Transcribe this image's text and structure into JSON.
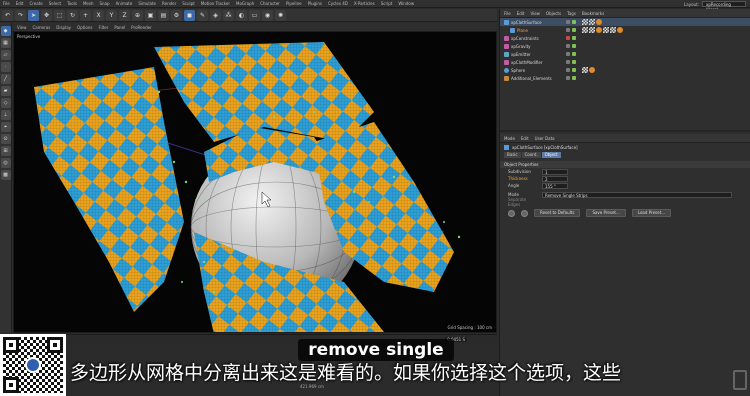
{
  "menubar": [
    "File",
    "Edit",
    "Create",
    "Select",
    "Tools",
    "Mesh",
    "Snap",
    "Animate",
    "Simulate",
    "Render",
    "Sculpt",
    "Motion Tracker",
    "MoGraph",
    "Character",
    "Pipeline",
    "Plugins",
    "Cycles 4D",
    "X-Particles",
    "Script",
    "Window"
  ],
  "layout": {
    "label": "Layout:",
    "value": "xpRecording (User)"
  },
  "toolbar": {
    "x_axis": "X",
    "y_axis": "Y",
    "z_axis": "Z"
  },
  "viewport": {
    "menu": [
      "View",
      "Cameras",
      "Display",
      "Options",
      "Filter",
      "Panel",
      "ProRender"
    ],
    "label": "Perspective",
    "grid_spacing": "Grid Spacing : 100 cm"
  },
  "timeline": {
    "field": "0.0451 S"
  },
  "coords": "421.969 cm",
  "object_manager": {
    "menu": [
      "File",
      "Edit",
      "View",
      "Objects",
      "Tags",
      "Bookmarks"
    ],
    "objects": [
      {
        "name": "xpClothSurface",
        "selected": true,
        "orange": false,
        "icon_color": "#5a9ad8"
      },
      {
        "name": "Plane",
        "selected": false,
        "orange": true,
        "icon_color": "#5a9ad8"
      },
      {
        "name": "xpConstraints",
        "selected": false,
        "orange": false,
        "icon_color": "#c25aa8"
      },
      {
        "name": "xpGravity",
        "selected": false,
        "orange": false,
        "icon_color": "#c25aa8"
      },
      {
        "name": "xpEmitter",
        "selected": false,
        "orange": false,
        "icon_color": "#5aa8c2"
      },
      {
        "name": "xpClothModifier",
        "selected": false,
        "orange": false,
        "icon_color": "#c25aa8"
      },
      {
        "name": "Sphere",
        "selected": false,
        "orange": false,
        "icon_color": "#5a9ad8"
      },
      {
        "name": "Additional_Elements",
        "selected": false,
        "orange": false,
        "icon_color": "#c28a3a"
      }
    ]
  },
  "attributes": {
    "menu": [
      "Mode",
      "Edit",
      "User Data"
    ],
    "title": "xpClothSurface [xpClothSurface]",
    "tabs": [
      "Basic",
      "Coord.",
      "Object"
    ],
    "section": "Object Properties",
    "props": [
      {
        "label": "Subdivision",
        "value": "1",
        "orange": false
      },
      {
        "label": "Thickness",
        "value": "2",
        "orange": true
      },
      {
        "label": "Angle",
        "value": "155 °",
        "orange": false
      }
    ],
    "mode": {
      "label": "Mode",
      "value": "Remove Single Strips"
    },
    "separate_edges": "Separate Edges",
    "buttons": [
      "Reset to Defaults",
      "Save Preset...",
      "Load Preset..."
    ]
  },
  "subtitles": {
    "english": "remove single",
    "chinese": "多边形从网格中分离出来这是难看的。如果你选择这个选项，这些"
  },
  "colors": {
    "cloth_orange": "#e8a21e",
    "cloth_blue": "#2e9fd6",
    "accent": "#5b7ba6"
  }
}
